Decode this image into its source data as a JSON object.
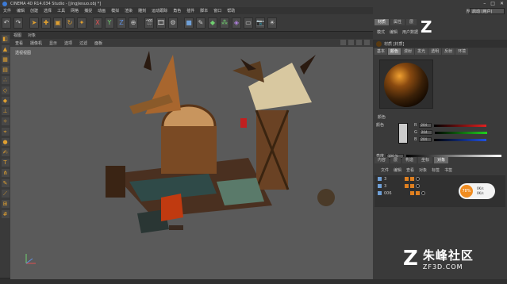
{
  "window": {
    "title": "CINEMA 4D R14.034 Studio - [jingjiesuo.obj *]"
  },
  "menubar": {
    "items": [
      "文件",
      "编辑",
      "创建",
      "选择",
      "工具",
      "网格",
      "捕捉",
      "动画",
      "模拟",
      "渲染",
      "雕刻",
      "运动跟踪",
      "角色",
      "插件",
      "脚本",
      "窗口",
      "帮助"
    ]
  },
  "viewport": {
    "tabs": [
      "视图",
      "对象"
    ],
    "menu": [
      "查看",
      "摄像机",
      "显示",
      "选项",
      "过滤",
      "面板"
    ],
    "label": "透视视图"
  },
  "right_panel": {
    "layout_label": "界面:",
    "layout_value": "启动 (用户)",
    "tabs": [
      "材质",
      "属性",
      "层"
    ],
    "menu": [
      "模式",
      "编辑",
      "用户数据"
    ],
    "material_name": "材质 [材质]",
    "channel_tabs": [
      "基本",
      "颜色",
      "漫射",
      "发光",
      "透明",
      "反射",
      "环境"
    ],
    "color_section": "颜色",
    "color_label": "颜色",
    "channels": [
      {
        "name": "R",
        "value": "204"
      },
      {
        "name": "G",
        "value": "204"
      },
      {
        "name": "B",
        "value": "204"
      }
    ],
    "brightness_label": "亮度",
    "brightness_value": "100 %"
  },
  "object_manager": {
    "tabs": [
      "内容",
      "层",
      "构造",
      "坐标",
      "对象"
    ],
    "menu": [
      "文件",
      "编辑",
      "查看",
      "对象",
      "标签",
      "书签"
    ],
    "rows": [
      {
        "name": "3"
      },
      {
        "name": "3"
      },
      {
        "name": "006"
      }
    ]
  },
  "net_badge": {
    "percent": "78%",
    "up": "0K/s",
    "down": "0K/s"
  },
  "watermark": {
    "logo": "Z",
    "text": "朱峰社区",
    "url": "ZF3D.COM"
  },
  "colors": {
    "accent": "#f08c20",
    "viewport_bg": "#5a5a5a",
    "panel_bg": "#3a3a3a"
  }
}
